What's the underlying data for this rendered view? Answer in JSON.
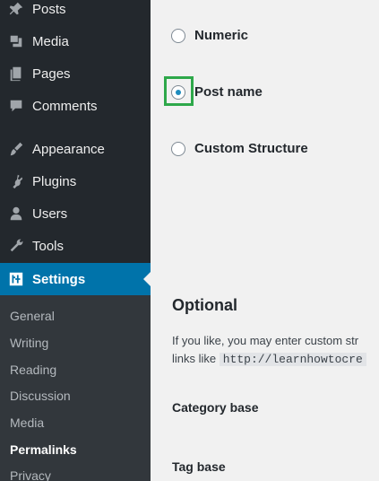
{
  "sidebar": {
    "menu": [
      {
        "label": "Posts",
        "icon": "pin-icon"
      },
      {
        "label": "Media",
        "icon": "media-icon"
      },
      {
        "label": "Pages",
        "icon": "pages-icon"
      },
      {
        "label": "Comments",
        "icon": "comment-icon"
      },
      {
        "label": "Appearance",
        "icon": "paintbrush-icon"
      },
      {
        "label": "Plugins",
        "icon": "plugin-icon"
      },
      {
        "label": "Users",
        "icon": "user-icon"
      },
      {
        "label": "Tools",
        "icon": "wrench-icon"
      },
      {
        "label": "Settings",
        "icon": "settings-icon"
      }
    ],
    "submenu": [
      "General",
      "Writing",
      "Reading",
      "Discussion",
      "Media",
      "Permalinks",
      "Privacy"
    ]
  },
  "main": {
    "options": [
      {
        "label": "Numeric",
        "checked": false
      },
      {
        "label": "Post name",
        "checked": true
      },
      {
        "label": "Custom Structure",
        "checked": false
      }
    ],
    "optional_heading": "Optional",
    "optional_text": "If you like, you may enter custom str",
    "links_like": "links like",
    "example_code": "http://learnhowtocre",
    "category_base": "Category base",
    "tag_base": "Tag base"
  },
  "colors": {
    "sidebar_bg": "#23282d",
    "submenu_bg": "#32373c",
    "active_bg": "#0073aa",
    "focus_outline": "#2ea84a",
    "content_bg": "#f1f1f1"
  }
}
